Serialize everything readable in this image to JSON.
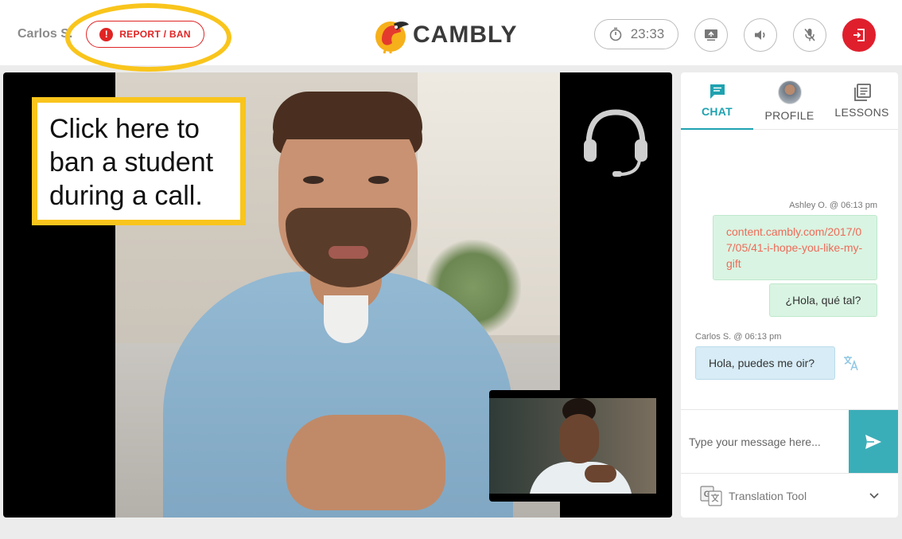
{
  "header": {
    "student_name": "Carlos S.",
    "report_label": "REPORT / BAN",
    "logo_text": "CAMBLY",
    "timer": "23:33"
  },
  "callout": {
    "text": "Click here to ban a student during a call."
  },
  "panel": {
    "tabs": [
      {
        "label": "CHAT",
        "icon": "chat-icon",
        "active": true
      },
      {
        "label": "PROFILE",
        "icon": "avatar",
        "active": false
      },
      {
        "label": "LESSONS",
        "icon": "lessons-icon",
        "active": false
      }
    ],
    "messages": [
      {
        "meta": "Ashley O. @ 06:13 pm",
        "text": "content.cambly.com/2017/07/05/41-i-hope-you-like-my-gift",
        "kind": "link"
      },
      {
        "text": "¿Hola, qué tal?",
        "kind": "mine"
      },
      {
        "meta": "Carlos S. @ 06:13 pm",
        "text": "Hola, puedes me oir?",
        "kind": "theirs"
      }
    ],
    "composer_placeholder": "Type your message here...",
    "translation_label": "Translation Tool"
  },
  "colors": {
    "accent_teal": "#1fa2b0",
    "danger_red": "#e02424",
    "highlight_yellow": "#f9c51c"
  }
}
